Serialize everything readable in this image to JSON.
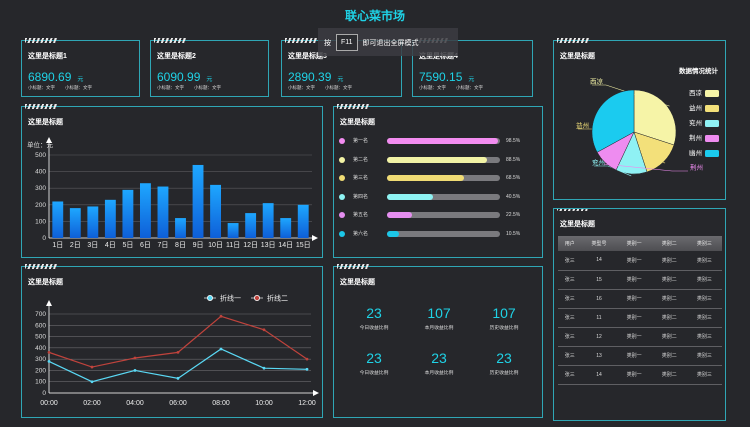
{
  "app": {
    "title": "联心菜市场"
  },
  "fullscreen_hint": {
    "prefix": "按",
    "key": "F11",
    "suffix": "即可退出全屏模式"
  },
  "stats": [
    {
      "title": "这里是标题1",
      "value": "6890.69",
      "unit": "元",
      "sub1": "小标题：文字",
      "sub2": "小标题：文字"
    },
    {
      "title": "这里是标题2",
      "value": "6090.99",
      "unit": "元",
      "sub1": "小标题：文字",
      "sub2": "小标题：文字"
    },
    {
      "title": "这里是标题3",
      "value": "2890.39",
      "unit": "元",
      "sub1": "小标题：文字",
      "sub2": "小标题：文字"
    },
    {
      "title": "这里是标题4",
      "value": "7590.15",
      "unit": "元",
      "sub1": "小标题：文字",
      "sub2": "小标题：文字"
    }
  ],
  "panels": {
    "bar": {
      "title": "这里是标题"
    },
    "rank": {
      "title": "这里是标题"
    },
    "line": {
      "title": "这里是标题"
    },
    "kpi": {
      "title": "这里是标题"
    },
    "pie": {
      "title": "这里是标题"
    },
    "table": {
      "title": "这里是标题"
    }
  },
  "ranking": [
    {
      "label": "第一名",
      "value": 98.5,
      "pct": "98.5%",
      "color": "#f28cf0"
    },
    {
      "label": "第二名",
      "value": 88.5,
      "pct": "88.5%",
      "color": "#f2f3a5"
    },
    {
      "label": "第三名",
      "value": 68.5,
      "pct": "68.5%",
      "color": "#f0dc74"
    },
    {
      "label": "第四名",
      "value": 40.5,
      "pct": "40.5%",
      "color": "#8ef3f3"
    },
    {
      "label": "第五名",
      "value": 22.5,
      "pct": "22.5%",
      "color": "#e58ef0"
    },
    {
      "label": "第六名",
      "value": 10.5,
      "pct": "10.5%",
      "color": "#1cc7e8"
    }
  ],
  "kpis": [
    {
      "value": "23",
      "label": "今日收益比例"
    },
    {
      "value": "107",
      "label": "本月收益比例"
    },
    {
      "value": "107",
      "label": "历史收益比例"
    },
    {
      "value": "23",
      "label": "今日收益比例"
    },
    {
      "value": "23",
      "label": "本月收益比例"
    },
    {
      "value": "23",
      "label": "历史收益比例"
    }
  ],
  "table": {
    "headers": [
      "用户",
      "类型号",
      "类别一",
      "类别二",
      "类别三"
    ],
    "rows": [
      [
        "张三",
        "14",
        "类别一",
        "类别二",
        "类别三"
      ],
      [
        "张三",
        "15",
        "类别一",
        "类别二",
        "类别三"
      ],
      [
        "张三",
        "16",
        "类别一",
        "类别二",
        "类别三"
      ],
      [
        "张三",
        "11",
        "类别一",
        "类别二",
        "类别三"
      ],
      [
        "张三",
        "12",
        "类别一",
        "类别二",
        "类别三"
      ],
      [
        "张三",
        "13",
        "类别一",
        "类别二",
        "类别三"
      ],
      [
        "张三",
        "14",
        "类别一",
        "类别二",
        "类别三"
      ]
    ]
  },
  "chart_data": [
    {
      "type": "bar",
      "ylabel": "单位：元",
      "categories": [
        "1日",
        "2日",
        "3日",
        "4日",
        "5日",
        "6日",
        "7日",
        "8日",
        "9日",
        "10日",
        "11日",
        "12日",
        "13日",
        "14日",
        "15日"
      ],
      "values": [
        220,
        180,
        190,
        230,
        290,
        330,
        310,
        120,
        440,
        320,
        90,
        150,
        210,
        120,
        200
      ],
      "ylim": [
        0,
        500
      ],
      "yticks": [
        0,
        100,
        200,
        300,
        400,
        500
      ],
      "colors": {
        "top": "#1ea7ff",
        "bottom": "#0e5fd8"
      }
    },
    {
      "type": "line",
      "categories": [
        "00:00",
        "02:00",
        "04:00",
        "06:00",
        "08:00",
        "10:00",
        "12:00"
      ],
      "series": [
        {
          "name": "折线一",
          "values": [
            280,
            100,
            200,
            130,
            390,
            220,
            210
          ],
          "color": "#5ad9f5"
        },
        {
          "name": "折线二",
          "values": [
            360,
            230,
            310,
            360,
            680,
            560,
            300
          ],
          "color": "#c0433c"
        }
      ],
      "ylim": [
        0,
        700
      ],
      "yticks": [
        0,
        100,
        200,
        300,
        400,
        500,
        600,
        700
      ]
    },
    {
      "type": "pie",
      "title": "数据情况统计",
      "slices": [
        {
          "name": "西凉",
          "value": 30,
          "color": "#f6f4a7"
        },
        {
          "name": "益州",
          "value": 15,
          "color": "#f3e07a"
        },
        {
          "name": "兖州",
          "value": 12,
          "color": "#8ff1f4"
        },
        {
          "name": "荆州",
          "value": 10,
          "color": "#ee8cf0"
        },
        {
          "name": "幽州",
          "value": 33,
          "color": "#1bcbef"
        }
      ]
    }
  ]
}
